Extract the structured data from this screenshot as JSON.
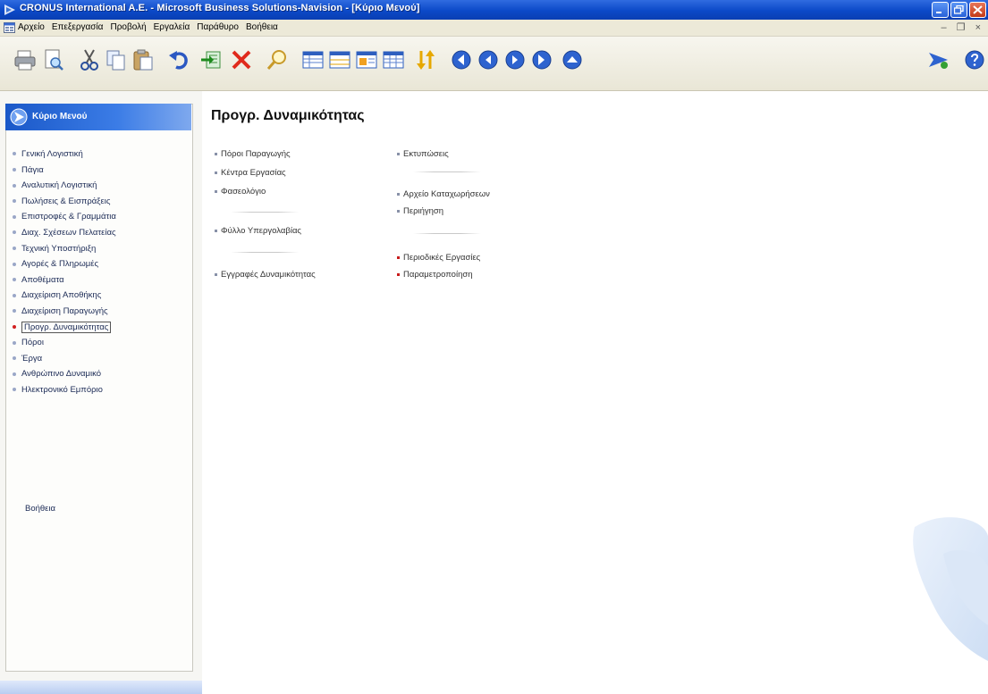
{
  "window": {
    "title": "CRONUS International A.E. - Microsoft Business Solutions-Navision - [Κύριο Μενού]"
  },
  "menubar": {
    "items": [
      "Αρχείο",
      "Επεξεργασία",
      "Προβολή",
      "Εργαλεία",
      "Παράθυρο",
      "Βοήθεια"
    ],
    "mdi_controls": "– ❐ ×"
  },
  "toolbar": {
    "icons": [
      "print-icon",
      "print-preview-icon",
      "cut-icon",
      "copy-icon",
      "paste-icon",
      "undo-icon",
      "import-icon",
      "delete-icon",
      "find-icon",
      "list-view-icon",
      "card-view-icon",
      "form-view-icon",
      "table-view-icon",
      "sort-icon",
      "nav-first-icon",
      "nav-previous-icon",
      "nav-next-icon",
      "nav-last-icon",
      "nav-up-icon",
      "connect-icon",
      "help-icon"
    ]
  },
  "sidebar": {
    "header_title": "Κύριο Μενού",
    "items": [
      "Γενική Λογιστική",
      "Πάγια",
      "Αναλυτική Λογιστική",
      "Πωλήσεις & Εισπράξεις",
      "Επιστροφές & Γραμμάτια",
      "Διαχ. Σχέσεων Πελατείας",
      "Τεχνική Υποστήριξη",
      "Αγορές & Πληρωμές",
      "Αποθέματα",
      "Διαχείριση Αποθήκης",
      "Διαχείριση Παραγωγής",
      "Προγρ. Δυναμικότητας",
      "Πόροι",
      "Έργα",
      "Ανθρώπινο Δυναμικό",
      "Ηλεκτρονικό Εμπόριο"
    ],
    "active_index": 11,
    "help_label": "Βοήθεια"
  },
  "content": {
    "title": "Προγρ. Δυναμικότητας",
    "left_links": [
      "Πόροι Παραγωγής",
      "Κέντρα Εργασίας",
      "Φασεολόγιο",
      "Φύλλο Υπεργολαβίας",
      "Εγγραφές Δυναμικότητας"
    ],
    "right_links": [
      "Εκτυπώσεις",
      "Αρχείο Καταχωρήσεων",
      "Περιήγηση",
      "Περιοδικές Εργασίες",
      "Παραμετροποίηση"
    ]
  },
  "colors": {
    "titlebar": "#0b49c8",
    "sidebar_header": "#1a58c8",
    "active_bullet": "#d12020",
    "chrome": "#ece9d8"
  }
}
